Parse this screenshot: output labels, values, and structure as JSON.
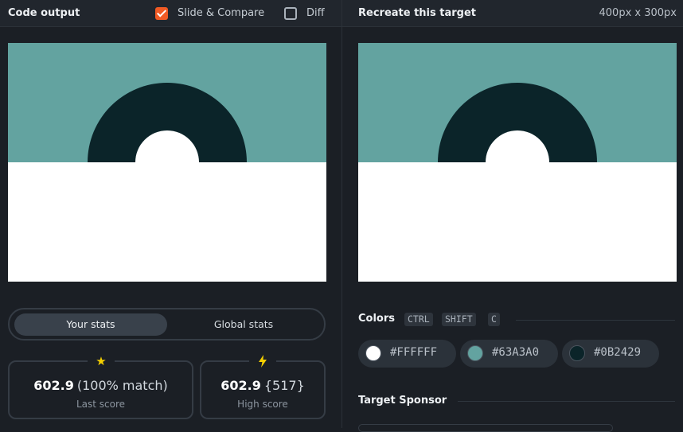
{
  "left_panel": {
    "title": "Code output",
    "slide_compare": {
      "label": "Slide & Compare",
      "checked": true
    },
    "diff": {
      "label": "Diff",
      "checked": false
    }
  },
  "right_panel": {
    "title": "Recreate this target",
    "dimensions": "400px x 300px"
  },
  "stats": {
    "tabs": [
      "Your stats",
      "Global stats"
    ],
    "active_tab": "Your stats",
    "last": {
      "icon": "star-icon",
      "score": "602.9",
      "detail": "(100% match)",
      "caption": "Last score"
    },
    "high": {
      "icon": "lightning-icon",
      "score": "602.9",
      "detail": "{517}",
      "caption": "High score"
    }
  },
  "colors": {
    "title": "Colors",
    "shortcut": [
      "CTRL",
      "SHIFT",
      "C"
    ],
    "swatches": [
      {
        "hex": "#FFFFFF"
      },
      {
        "hex": "#63A3A0"
      },
      {
        "hex": "#0B2429"
      }
    ]
  },
  "sponsor": {
    "title": "Target Sponsor"
  },
  "theme": {
    "accent": "#f05a24",
    "icon_yellow": "#f5d000"
  }
}
